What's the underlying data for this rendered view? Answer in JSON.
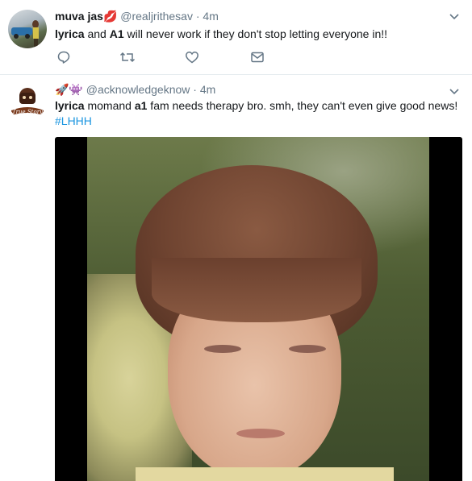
{
  "tweets": [
    {
      "display_name": "muva jas",
      "name_emoji": "💋",
      "handle": "@realjrithesav",
      "separator": "·",
      "time": "4m",
      "text_parts": [
        "lyrica",
        " and ",
        "A1",
        " will never work if they don't stop letting everyone in!!"
      ],
      "actions": [
        "reply-icon",
        "retweet-icon",
        "like-icon",
        "message-icon"
      ]
    },
    {
      "display_name_emojis": "🚀👾",
      "handle": "@acknowledgeknow",
      "separator": "·",
      "time": "4m",
      "text_parts": [
        "lyrica",
        " momand ",
        "a1",
        " fam needs therapy bro. smh, they can't even give good news!"
      ],
      "hashtag": "#LHHH",
      "avatar_logo_text": "True Story",
      "media": "photo of a squinting boy with brown hair"
    }
  ],
  "colors": {
    "link": "#1b95e0",
    "secondary": "#657786",
    "divider": "#e6ecf0"
  }
}
